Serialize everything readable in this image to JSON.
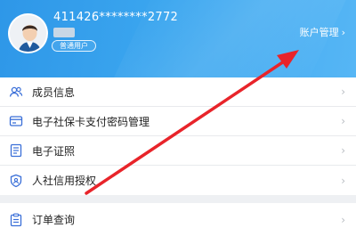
{
  "profile": {
    "account_id": "411426********2772",
    "user_type": "普通用户",
    "account_manage_label": "账户管理"
  },
  "menu": {
    "items": [
      {
        "label": "成员信息",
        "icon": "members-icon"
      },
      {
        "label": "电子社保卡支付密码管理",
        "icon": "card-password-icon"
      },
      {
        "label": "电子证照",
        "icon": "certificate-icon"
      },
      {
        "label": "人社信用授权",
        "icon": "credit-shield-icon"
      }
    ],
    "order": {
      "label": "订单查询",
      "icon": "clipboard-icon"
    }
  },
  "colors": {
    "header_blue": "#3ba6ef",
    "annotation_red": "#e8242a",
    "icon_blue": "#3a6fd8"
  }
}
